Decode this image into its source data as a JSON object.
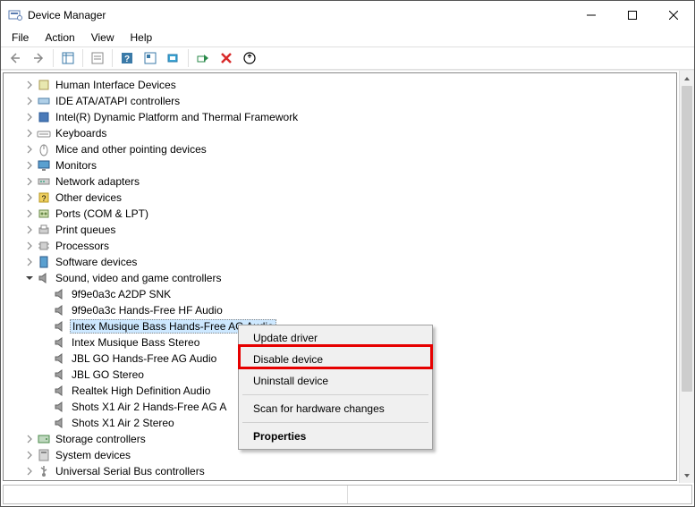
{
  "window": {
    "title": "Device Manager"
  },
  "menu": {
    "items": [
      "File",
      "Action",
      "View",
      "Help"
    ]
  },
  "tree": {
    "collapsed": [
      "Human Interface Devices",
      "IDE ATA/ATAPI controllers",
      "Intel(R) Dynamic Platform and Thermal Framework",
      "Keyboards",
      "Mice and other pointing devices",
      "Monitors",
      "Network adapters",
      "Other devices",
      "Ports (COM & LPT)",
      "Print queues",
      "Processors",
      "Software devices"
    ],
    "expanded": {
      "label": "Sound, video and game controllers",
      "children": [
        "9f9e0a3c A2DP SNK",
        "9f9e0a3c Hands-Free HF Audio",
        "Intex Musique Bass Hands-Free AG Audio",
        "Intex Musique Bass Stereo",
        "JBL GO Hands-Free AG Audio",
        "JBL GO Stereo",
        "Realtek High Definition Audio",
        "Shots X1 Air 2 Hands-Free AG A",
        "Shots X1 Air 2 Stereo"
      ],
      "selected_index": 2
    },
    "after": [
      "Storage controllers",
      "System devices",
      "Universal Serial Bus controllers"
    ]
  },
  "context_menu": {
    "items": [
      {
        "label": "Update driver"
      },
      {
        "label": "Disable device",
        "highlighted": true
      },
      {
        "label": "Uninstall device"
      },
      {
        "sep": true
      },
      {
        "label": "Scan for hardware changes"
      },
      {
        "sep": true
      },
      {
        "label": "Properties",
        "bold": true
      }
    ]
  }
}
